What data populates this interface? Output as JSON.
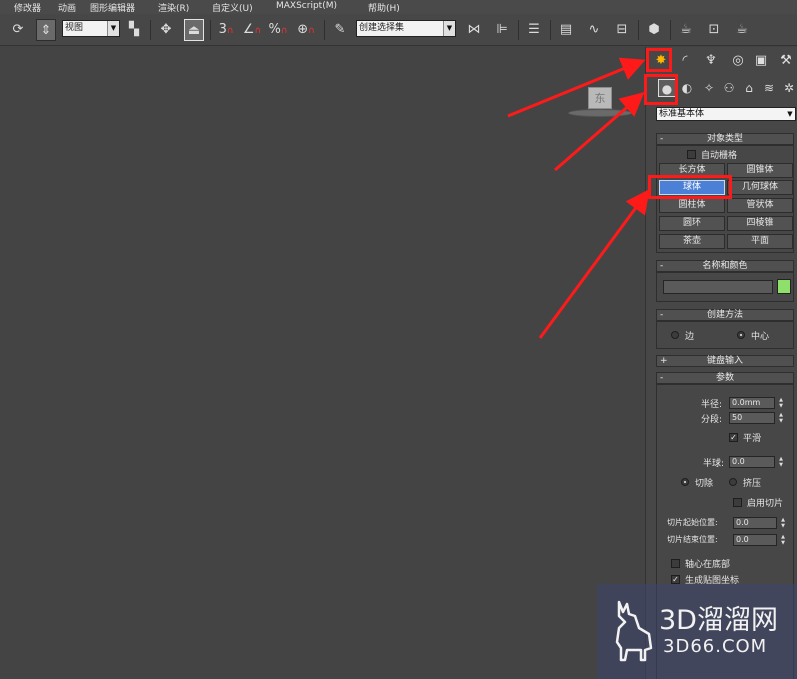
{
  "menu": {
    "items": [
      "修改器",
      "动画",
      "图形编辑器",
      "渲染(R)",
      "自定义(U)",
      "MAXScript(M)",
      "帮助(H)"
    ]
  },
  "toolbar": {
    "view_combo": "视图",
    "selection_set_combo": "创建选择集",
    "snap_3_label": "3",
    "angle_snap_label": "∠",
    "percent_snap_label": "%",
    "spinner_snap_label": "⊕"
  },
  "viewport": {
    "viewcube_face_label": "东"
  },
  "panel": {
    "category_dropdown": "标准基本体",
    "object_type": {
      "title": "对象类型",
      "autogrid_label": "自动栅格",
      "buttons": [
        "长方体",
        "圆锥体",
        "球体",
        "几何球体",
        "圆柱体",
        "管状体",
        "圆环",
        "四棱锥",
        "茶壶",
        "平面"
      ]
    },
    "name_color": {
      "title": "名称和颜色",
      "name_value": "",
      "swatch_color": "#8ee06a"
    },
    "creation_method": {
      "title": "创建方法",
      "edge_label": "边",
      "center_label": "中心"
    },
    "keyboard_entry": {
      "title": "键盘输入"
    },
    "parameters": {
      "title": "参数",
      "radius_label": "半径:",
      "radius_value": "0.0mm",
      "segments_label": "分段:",
      "segments_value": "50",
      "smooth_label": "平滑",
      "hemisphere_label": "半球:",
      "hemisphere_value": "0.0",
      "chop_label": "切除",
      "squash_label": "挤压",
      "enable_slice_label": "启用切片",
      "slice_from_label": "切片起始位置:",
      "slice_from_value": "0.0",
      "slice_to_label": "切片结束位置:",
      "slice_to_value": "0.0",
      "base_to_pivot_label": "轴心在底部",
      "gen_mapping_label": "生成贴图坐标"
    }
  },
  "watermark": {
    "title": "3D溜溜网",
    "subtitle": "3D66.COM"
  },
  "colors": {
    "annotation_red": "#ff1a1a",
    "active_button_blue": "#4c7fd6"
  }
}
